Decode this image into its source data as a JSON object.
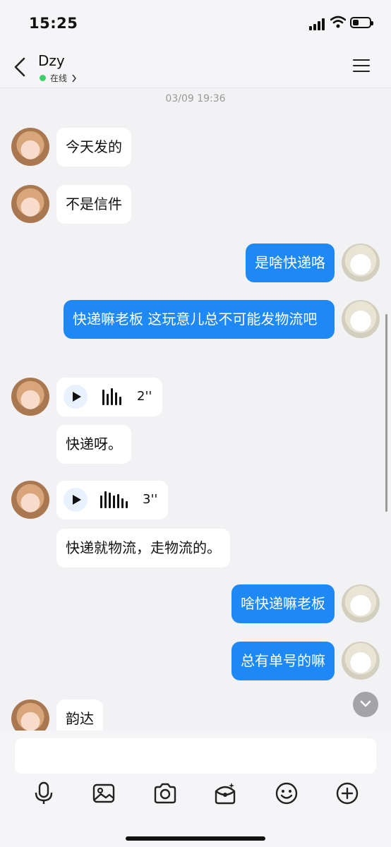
{
  "status": {
    "time": "15:25"
  },
  "header": {
    "contact_name": "Dzy",
    "online_status": "在线"
  },
  "chat": {
    "date_separator": "03/09 19:36",
    "messages": [
      {
        "side": "in",
        "type": "text",
        "text": "今天发的"
      },
      {
        "side": "in",
        "type": "text",
        "text": "不是信件"
      },
      {
        "side": "out",
        "type": "text",
        "text": "是啥快递咯"
      },
      {
        "side": "out",
        "type": "text",
        "text": "快递嘛老板 这玩意儿总不可能发物流吧"
      },
      {
        "side": "in",
        "type": "voice",
        "duration": "2''"
      },
      {
        "side": "in",
        "type": "text",
        "text": "快递呀。"
      },
      {
        "side": "in",
        "type": "voice",
        "duration": "3''"
      },
      {
        "side": "in",
        "type": "text",
        "text": "快递就物流，走物流的。"
      },
      {
        "side": "out",
        "type": "text",
        "text": "啥快递嘛老板"
      },
      {
        "side": "out",
        "type": "text",
        "text": "总有单号的嘛"
      },
      {
        "side": "in",
        "type": "text",
        "text": "韵达"
      }
    ]
  },
  "input": {
    "placeholder": ""
  },
  "toolbar": [
    "microphone-icon",
    "image-icon",
    "camera-icon",
    "red-packet-icon",
    "emoji-icon",
    "plus-icon"
  ],
  "colors": {
    "outgoing_bubble": "#1e88f5",
    "incoming_bubble": "#ffffff",
    "background": "#f2f2f4",
    "online": "#3ecf6b"
  }
}
